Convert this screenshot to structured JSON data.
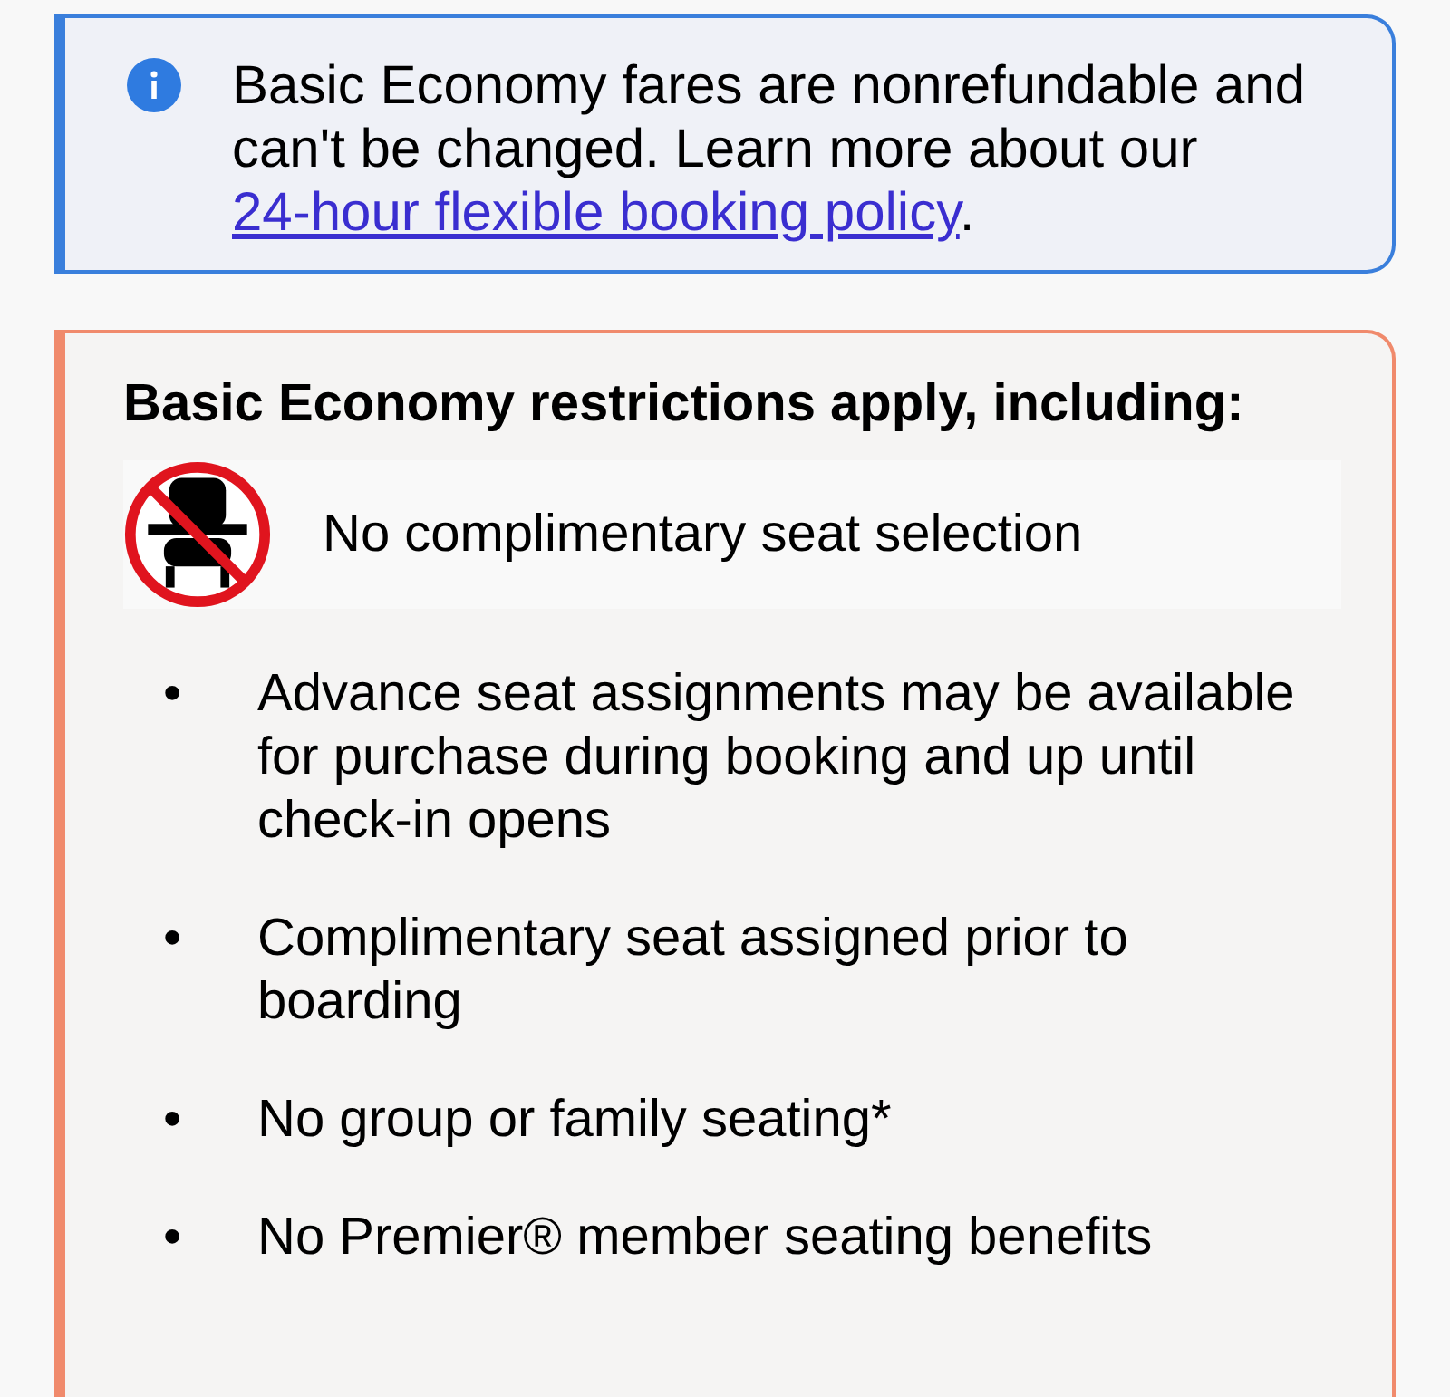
{
  "notice": {
    "text": "Basic Economy fares are nonrefundable and can't be changed. Learn more about our ",
    "link": "24-hour flexible booking policy",
    "after": "."
  },
  "restrictions": {
    "title": "Basic Economy restrictions apply, including:",
    "headline": "No complimentary seat selection",
    "items": [
      {
        "bullet": "•",
        "text": "Advance seat assignments may be available for purchase during booking and up until check-in opens"
      },
      {
        "bullet": "•",
        "text": "Complimentary seat assigned prior to boarding"
      },
      {
        "bullet": "•",
        "text": "No group or family seating*"
      },
      {
        "bullet": "•",
        "text": "No Premier® member seating benefits"
      }
    ]
  }
}
